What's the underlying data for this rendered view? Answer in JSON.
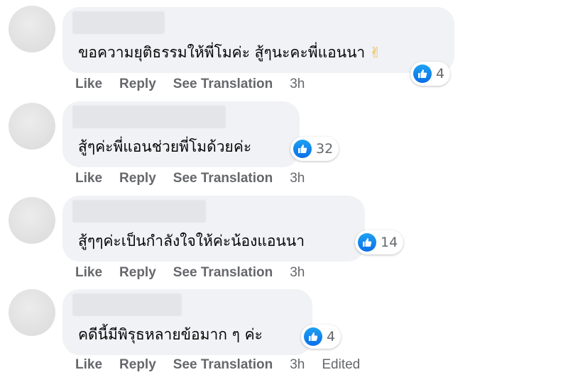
{
  "comments": [
    {
      "text": "ขอความยุติธรรมให้พี่โมค่ะ สู้ๆนะคะพี่แอนนา",
      "emoji": "✌",
      "reaction_count": "4",
      "actions": {
        "like": "Like",
        "reply": "Reply",
        "translate": "See Translation",
        "time": "3h"
      }
    },
    {
      "text": "สู้ๆค่ะพี่แอนช่วยพี่โมด้วยค่ะ",
      "reaction_count": "32",
      "actions": {
        "like": "Like",
        "reply": "Reply",
        "translate": "See Translation",
        "time": "3h"
      }
    },
    {
      "text": "สู้ๆๆค่ะเป็นกำลังใจให้ค่ะน้องแอนนา",
      "reaction_count": "14",
      "actions": {
        "like": "Like",
        "reply": "Reply",
        "translate": "See Translation",
        "time": "3h"
      }
    },
    {
      "text": "คดีนี้มีพิรุธหลายข้อมาก ๆ ค่ะ",
      "reaction_count": "4",
      "actions": {
        "like": "Like",
        "reply": "Reply",
        "translate": "See Translation",
        "time": "3h",
        "edited": "Edited"
      }
    }
  ],
  "reaction_icon": "like-icon",
  "colors": {
    "bubble": "#f0f2f5",
    "text": "#050505",
    "muted": "#65676b",
    "like_blue": "#1877f2"
  }
}
